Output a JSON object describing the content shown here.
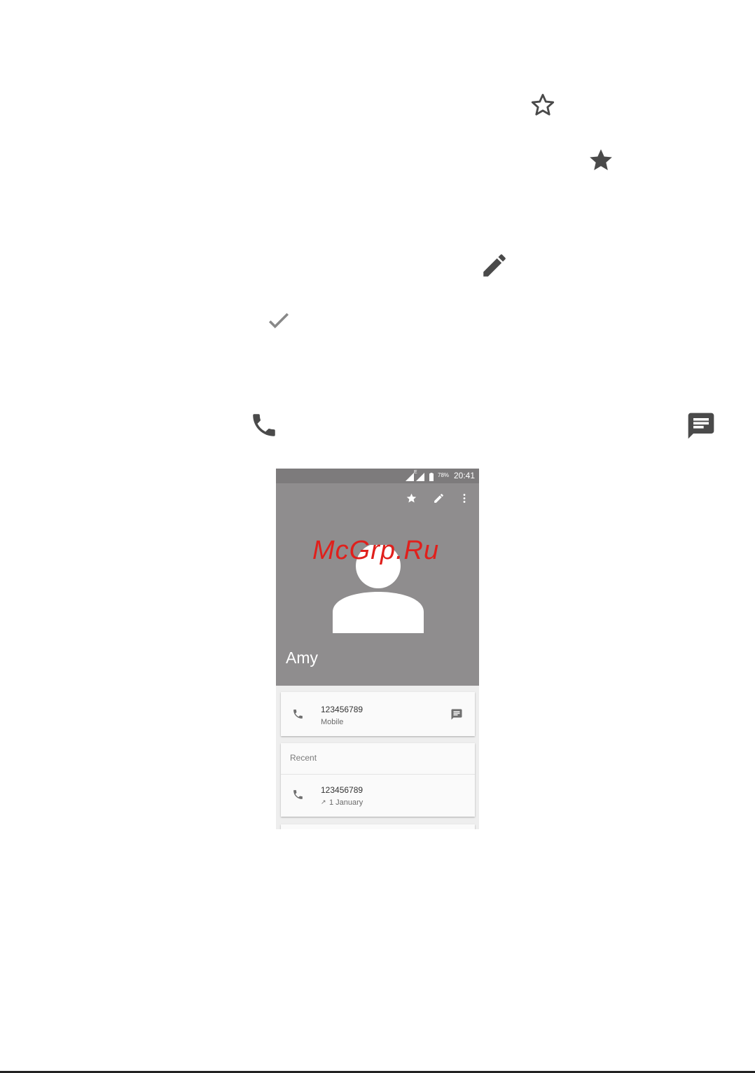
{
  "doc_icons": {
    "star_outline": "star-outline-icon",
    "star_filled": "star-filled-icon",
    "edit": "edit-pencil-icon",
    "check": "check-icon",
    "phone": "phone-icon",
    "message": "message-icon"
  },
  "colors": {
    "icon": "#4a4a4a",
    "header_bg": "#8f8d8e",
    "status_bg": "#7d7b7c",
    "card_bg": "#fafafa",
    "watermark": "#e0201c"
  },
  "screenshot": {
    "status_bar": {
      "battery_percent": "78%",
      "time": "20:41",
      "network_label": "E"
    },
    "toolbar": {
      "star_icon": "star-icon",
      "edit_icon": "edit-icon",
      "more_icon": "more-vert-icon"
    },
    "watermark": "McGrp.Ru",
    "contact": {
      "name": "Amy"
    },
    "phone_card": {
      "number": "123456789",
      "type": "Mobile"
    },
    "recent_card": {
      "header": "Recent",
      "number": "123456789",
      "date": "1 January",
      "direction_glyph": "↗"
    }
  }
}
